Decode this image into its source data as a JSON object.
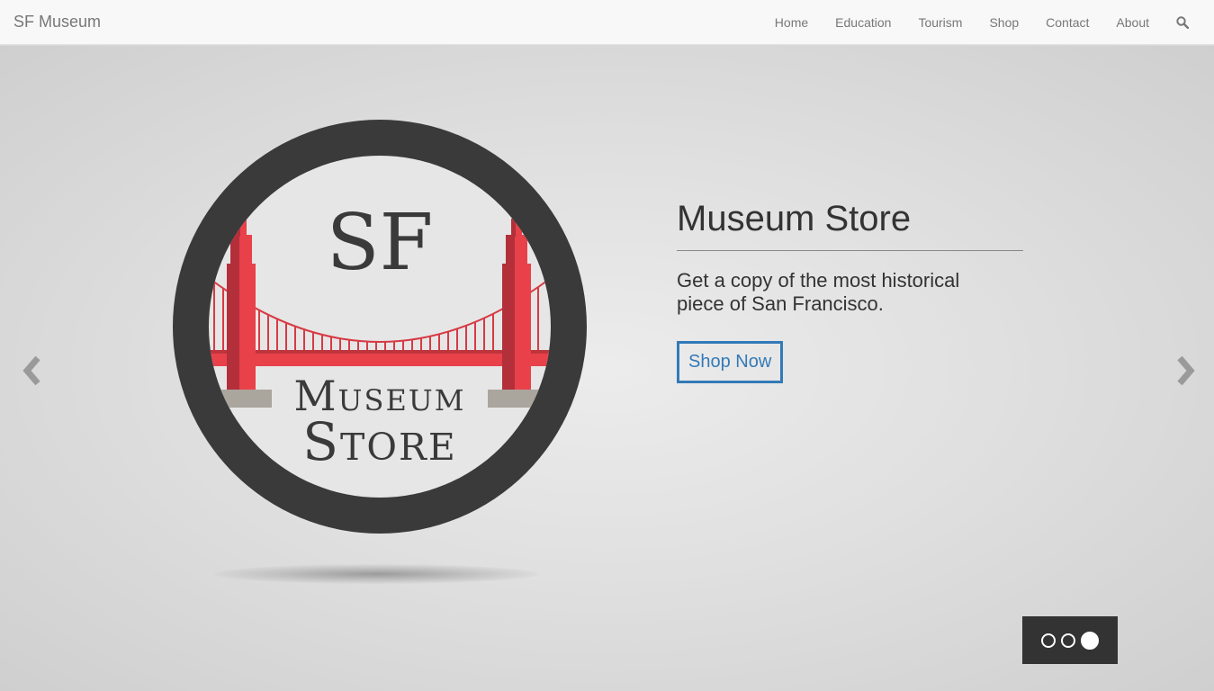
{
  "navbar": {
    "brand": "SF Museum",
    "items": [
      {
        "label": "Home"
      },
      {
        "label": "Education"
      },
      {
        "label": "Tourism"
      },
      {
        "label": "Shop"
      },
      {
        "label": "Contact"
      },
      {
        "label": "About"
      }
    ],
    "search_icon": "search-icon"
  },
  "carousel": {
    "logo": {
      "top_text": "SF",
      "line1": "Museum",
      "line2": "Store"
    },
    "caption": {
      "title": "Museum Store",
      "text": "Get a copy of the most historical piece of San Francisco.",
      "button_label": "Shop Now"
    },
    "prev_icon": "chevron-left-icon",
    "next_icon": "chevron-right-icon",
    "slide_count": 3,
    "active_slide": 3
  },
  "colors": {
    "accent": "#337ab7",
    "bridge_red": "#e8414a",
    "ring": "#3a3a3a"
  }
}
